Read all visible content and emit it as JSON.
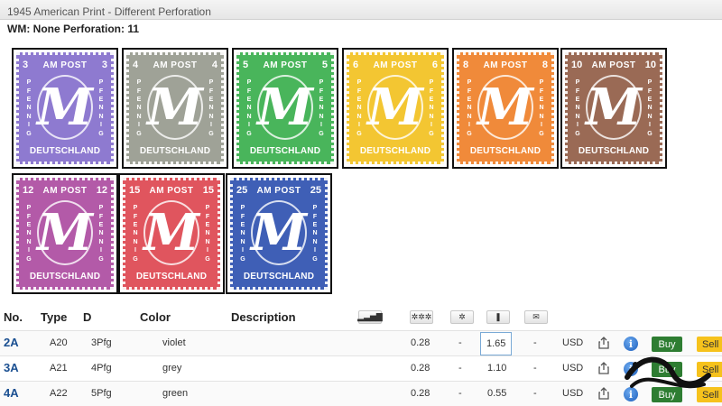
{
  "header": {
    "title": "1945 American Print - Different Perforation",
    "wm_perf": "WM: None Perforation: 11"
  },
  "stamps": [
    {
      "value": "3",
      "text_top": "AM POST",
      "text_bottom": "DEUTSCHLAND",
      "side": "PFENNIG",
      "color": "#8e7ad0"
    },
    {
      "value": "4",
      "text_top": "AM POST",
      "text_bottom": "DEUTSCHLAND",
      "side": "PFENNIG",
      "color": "#9fa297"
    },
    {
      "value": "5",
      "text_top": "AM POST",
      "text_bottom": "DEUTSCHLAND",
      "side": "PFENNIG",
      "color": "#49b55b"
    },
    {
      "value": "6",
      "text_top": "AM POST",
      "text_bottom": "DEUTSCHLAND",
      "side": "PFENNIG",
      "color": "#f3c632"
    },
    {
      "value": "8",
      "text_top": "AM POST",
      "text_bottom": "DEUTSCHLAND",
      "side": "PFENNIG",
      "color": "#f08a3a"
    },
    {
      "value": "10",
      "text_top": "AM POST",
      "text_bottom": "DEUTSCHLAND",
      "side": "PFENNIG",
      "color": "#9a6a55"
    },
    {
      "value": "12",
      "text_top": "AM POST",
      "text_bottom": "DEUTSCHLAND",
      "side": "PFENNIG",
      "color": "#b35aa8"
    },
    {
      "value": "15",
      "text_top": "AM POST",
      "text_bottom": "DEUTSCHLAND",
      "side": "PFENNIG",
      "color": "#e0555e"
    },
    {
      "value": "25",
      "text_top": "AM POST",
      "text_bottom": "DEUTSCHLAND",
      "side": "PFENNIG",
      "color": "#3f5fb6"
    }
  ],
  "table": {
    "headers": {
      "no": "No.",
      "type": "Type",
      "d": "D",
      "color": "Color",
      "description": "Description"
    },
    "header_icons": [
      "chart-icon",
      "mint-icon",
      "used-icon",
      "fine-icon",
      "letter-icon"
    ],
    "header_icon_glyphs": [
      "▂▃▅▇",
      "✲✲✲",
      "✲",
      "❚",
      "✉"
    ],
    "rows": [
      {
        "no": "2A",
        "type": "A20",
        "d": "3Pfg",
        "color": "violet",
        "mint": "0.28",
        "used": "-",
        "fine": "1.65",
        "letter": "-",
        "currency": "USD",
        "buy": "Buy",
        "sell": "Sell"
      },
      {
        "no": "3A",
        "type": "A21",
        "d": "4Pfg",
        "color": "grey",
        "mint": "0.28",
        "used": "-",
        "fine": "1.10",
        "letter": "-",
        "currency": "USD",
        "buy": "Buy",
        "sell": "Sell"
      },
      {
        "no": "4A",
        "type": "A22",
        "d": "5Pfg",
        "color": "green",
        "mint": "0.28",
        "used": "-",
        "fine": "0.55",
        "letter": "-",
        "currency": "USD",
        "buy": "Buy",
        "sell": "Sell"
      }
    ],
    "info_glyph": "i"
  }
}
